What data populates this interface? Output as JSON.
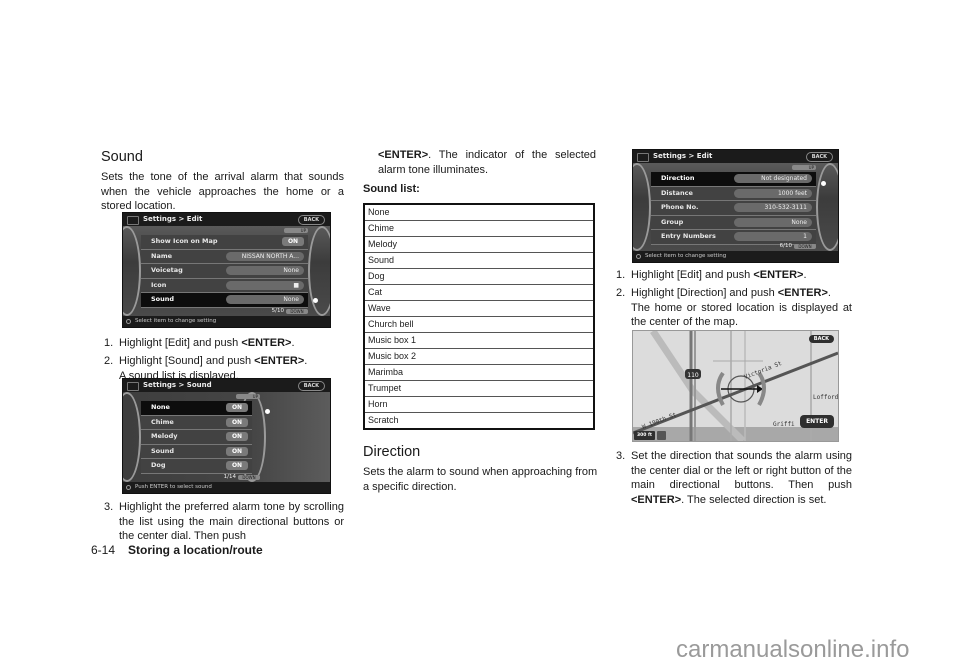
{
  "left_column": {
    "heading": "Sound",
    "intro": "Sets the tone of the arrival alarm that sounds when the vehicle approaches the home or a stored location.",
    "screen1": {
      "title": "Settings > Edit",
      "back_label": "BACK",
      "up_label": "UP",
      "down_label": "DOWN",
      "rows": [
        {
          "label": "Show Icon on Map",
          "value": "ON"
        },
        {
          "label": "Name",
          "value": "NISSAN NORTH A..."
        },
        {
          "label": "Voicetag",
          "value": "None"
        },
        {
          "label": "Icon",
          "value": "■"
        },
        {
          "label": "Sound",
          "value": "None"
        }
      ],
      "page": "5/10",
      "status": "Select item to change setting"
    },
    "steps": [
      {
        "num": "1.",
        "text": "Highlight [Edit] and push ",
        "key": "<ENTER>",
        "after": "."
      },
      {
        "num": "2.",
        "text": "Highlight [Sound] and push ",
        "key": "<ENTER>",
        "after": ".",
        "cont": "A sound list is displayed."
      }
    ],
    "screen2": {
      "title": "Settings > Sound",
      "back_label": "BACK",
      "up_label": "UP",
      "down_label": "DOWN",
      "rows": [
        {
          "label": "None",
          "value": "ON"
        },
        {
          "label": "Chime",
          "value": "ON"
        },
        {
          "label": "Melody",
          "value": "ON"
        },
        {
          "label": "Sound",
          "value": "ON"
        },
        {
          "label": "Dog",
          "value": "ON"
        }
      ],
      "page": "1/14",
      "status": "Push ENTER to select sound"
    },
    "step3": {
      "num": "3.",
      "text": "Highlight the preferred alarm tone by scrolling the list using the main directional buttons or the center dial. Then push"
    }
  },
  "middle_column": {
    "step3_cont_key": "<ENTER>",
    "step3_cont": ". The indicator of the selected alarm tone illuminates.",
    "list_heading": "Sound list:",
    "sound_list": [
      "None",
      "Chime",
      "Melody",
      "Sound",
      "Dog",
      "Cat",
      "Wave",
      "Church bell",
      "Music box 1",
      "Music box 2",
      "Marimba",
      "Trumpet",
      "Horn",
      "Scratch"
    ],
    "heading": "Direction",
    "intro": "Sets the alarm to sound when approaching from a specific direction."
  },
  "right_column": {
    "screen3": {
      "title": "Settings > Edit",
      "back_label": "BACK",
      "up_label": "UP",
      "down_label": "DOWN",
      "rows": [
        {
          "label": "Direction",
          "value": "Not designated"
        },
        {
          "label": "Distance",
          "value": "1000 feet"
        },
        {
          "label": "Phone No.",
          "value": "310-532-3111"
        },
        {
          "label": "Group",
          "value": "None"
        },
        {
          "label": "Entry Numbers",
          "value": "1"
        }
      ],
      "page": "6/10",
      "status": "Select item to change setting"
    },
    "steps": [
      {
        "num": "1.",
        "text": "Highlight [Edit] and push ",
        "key": "<ENTER>",
        "after": "."
      },
      {
        "num": "2.",
        "text": "Highlight [Direction] and push ",
        "key": "<ENTER>",
        "after": ".",
        "cont": "The home or stored location is displayed at the center of the map."
      }
    ],
    "map": {
      "back_label": "BACK",
      "enter_label": "ENTER",
      "scale_label": "300 ft",
      "street_labels": [
        "W 190th St",
        "Victoria St",
        "Griffi",
        "Lofford S"
      ],
      "route_shield": "110"
    },
    "step3": {
      "num": "3.",
      "text": "Set the direction that sounds the alarm using the center dial or the left or right button of the main directional buttons. Then push ",
      "key": "<ENTER>",
      "after": ". The selected direction is set."
    }
  },
  "footer": {
    "page_number": "6-14",
    "section_title": "Storing a location/route"
  },
  "watermark": "carmanualsonline.info"
}
